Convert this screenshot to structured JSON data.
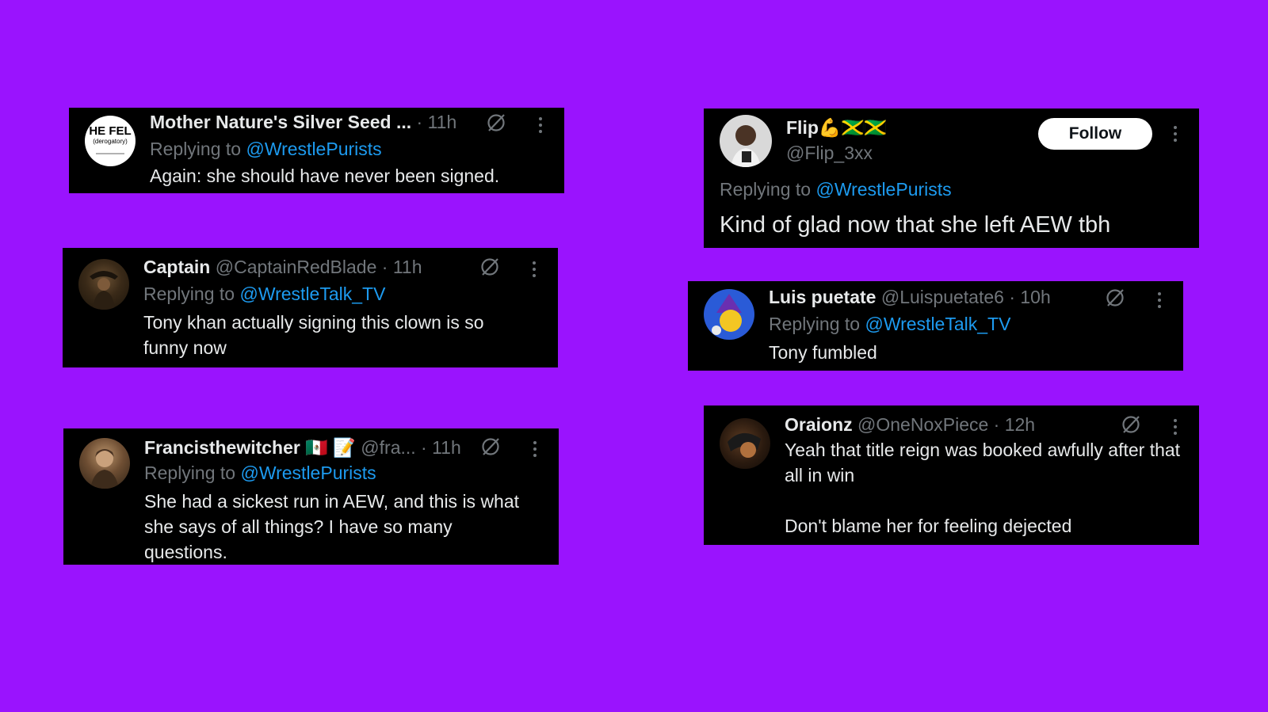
{
  "tweets": [
    {
      "name": "Mother Nature's Silver Seed ...",
      "handle": "",
      "time": "· 11h",
      "replying_prefix": "Replying to ",
      "replying_to": "@WrestlePurists",
      "text": "Again: she should have never been signed.",
      "avatar_text_main": "HE FEL",
      "avatar_text_sub": "(derogatory)"
    },
    {
      "name": "Captain",
      "handle": "@CaptainRedBlade",
      "time": "· 11h",
      "replying_prefix": "Replying to ",
      "replying_to": "@WrestleTalk_TV",
      "text": "Tony khan actually signing this clown is so funny now"
    },
    {
      "name": "Francisthewitcher 🇲🇽 📝",
      "handle": "@fra...",
      "time": "· 11h",
      "replying_prefix": "Replying to ",
      "replying_to": "@WrestlePurists",
      "text": "She had a sickest run in AEW, and this is what she says of all things? I have so many questions."
    },
    {
      "name": "Flip💪🇯🇲🇯🇲",
      "handle": "@Flip_3xx",
      "follow_label": "Follow",
      "replying_prefix": "Replying to ",
      "replying_to": "@WrestlePurists",
      "text": "Kind of glad now that she left AEW tbh"
    },
    {
      "name": "Luis puetate",
      "handle": "@Luispuetate6",
      "time": "· 10h",
      "replying_prefix": "Replying to ",
      "replying_to": "@WrestleTalk_TV",
      "text": "Tony fumbled"
    },
    {
      "name": "Oraionz",
      "handle": "@OneNoxPiece",
      "time": "· 12h",
      "text_line1": "Yeah that title reign was booked awfully after that all in win",
      "text_line2": "Don't blame her for feeling dejected"
    }
  ],
  "colors": {
    "background": "#9a13fe",
    "card": "#000000",
    "link": "#1d9bf0",
    "muted": "#71767b",
    "text": "#e7e9ea"
  },
  "icons": [
    "grok-icon",
    "more-icon"
  ]
}
